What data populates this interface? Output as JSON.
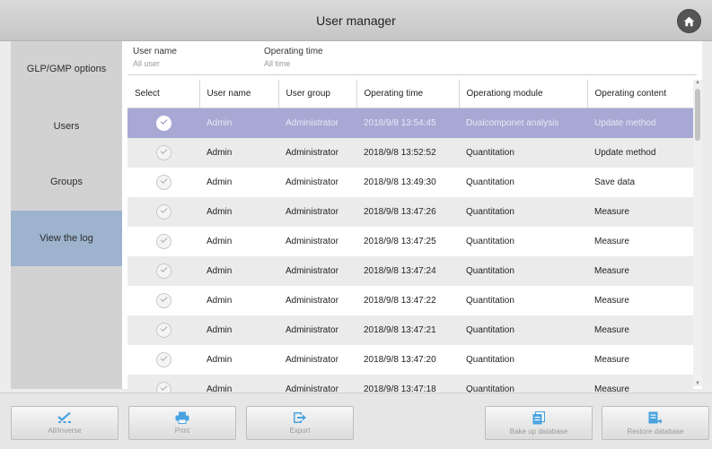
{
  "window": {
    "title": "User manager"
  },
  "sidebar": {
    "items": [
      {
        "label": "GLP/GMP options",
        "active": false
      },
      {
        "label": "Users",
        "active": false
      },
      {
        "label": "Groups",
        "active": false
      },
      {
        "label": "View the log",
        "active": true
      }
    ]
  },
  "filters": {
    "user_name": {
      "label": "User name",
      "value": "All user"
    },
    "operating_time": {
      "label": "Operating time",
      "value": "All time"
    }
  },
  "table": {
    "columns": [
      "Select",
      "User name",
      "User group",
      "Operating time",
      "Operationg module",
      "Operating content"
    ],
    "rows": [
      {
        "user": "Admin",
        "group": "Administrator",
        "time": "2018/9/8 13:54:45",
        "module": "Dualcomponet analysis",
        "content": "Update method",
        "selected": true
      },
      {
        "user": "Admin",
        "group": "Administrator",
        "time": "2018/9/8 13:52:52",
        "module": "Quantitation",
        "content": "Update method",
        "selected": false
      },
      {
        "user": "Admin",
        "group": "Administrator",
        "time": "2018/9/8 13:49:30",
        "module": "Quantitation",
        "content": "Save data",
        "selected": false
      },
      {
        "user": "Admin",
        "group": "Administrator",
        "time": "2018/9/8 13:47:26",
        "module": "Quantitation",
        "content": "Measure",
        "selected": false
      },
      {
        "user": "Admin",
        "group": "Administrator",
        "time": "2018/9/8 13:47:25",
        "module": "Quantitation",
        "content": "Measure",
        "selected": false
      },
      {
        "user": "Admin",
        "group": "Administrator",
        "time": "2018/9/8 13:47:24",
        "module": "Quantitation",
        "content": "Measure",
        "selected": false
      },
      {
        "user": "Admin",
        "group": "Administrator",
        "time": "2018/9/8 13:47:22",
        "module": "Quantitation",
        "content": "Measure",
        "selected": false
      },
      {
        "user": "Admin",
        "group": "Administrator",
        "time": "2018/9/8 13:47:21",
        "module": "Quantitation",
        "content": "Measure",
        "selected": false
      },
      {
        "user": "Admin",
        "group": "Administrator",
        "time": "2018/9/8 13:47:20",
        "module": "Quantitation",
        "content": "Measure",
        "selected": false
      },
      {
        "user": "Admin",
        "group": "Administrator",
        "time": "2018/9/8 13:47:18",
        "module": "Quantitation",
        "content": "Measure",
        "selected": false
      }
    ]
  },
  "footer": {
    "buttons": [
      {
        "label": "All/Inverse",
        "icon": "select-all-icon"
      },
      {
        "label": "Print",
        "icon": "printer-icon"
      },
      {
        "label": "Export",
        "icon": "export-icon"
      },
      {
        "label": "Bake up database",
        "icon": "backup-database-icon"
      },
      {
        "label": "Restore database",
        "icon": "restore-database-icon"
      }
    ]
  },
  "colors": {
    "accent": "#4aa3df",
    "sidebar_active": "#9db3ce",
    "selected_row": "#a7a9d4"
  }
}
